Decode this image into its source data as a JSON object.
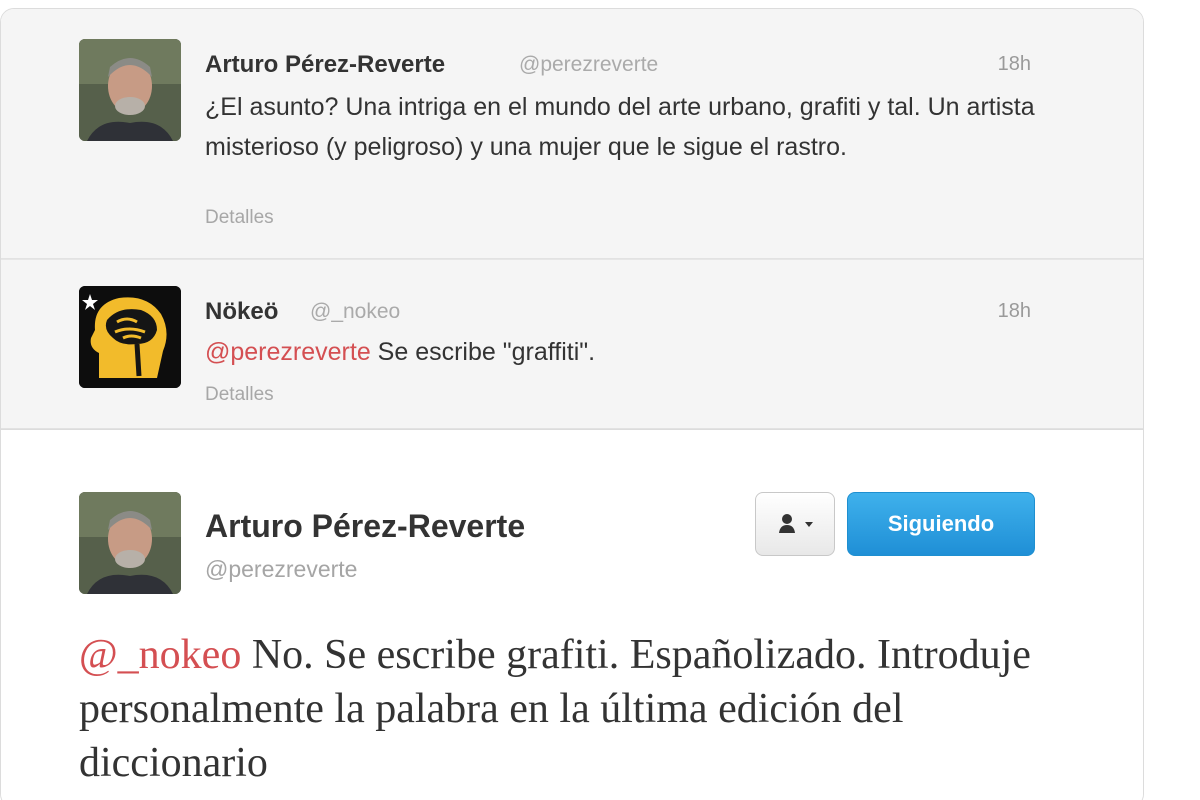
{
  "tweets": [
    {
      "name": "Arturo Pérez-Reverte",
      "handle": "@perezreverte",
      "time": "18h",
      "text": "¿El asunto? Una intriga en el mundo del arte urbano, grafiti y tal. Un artista misterioso (y peligroso) y una mujer que le sigue el rastro.",
      "details": "Detalles"
    },
    {
      "name": "Nökeö",
      "handle": "@_nokeo",
      "time": "18h",
      "mention": "@perezreverte",
      "text": " Se escribe \"graffiti\".",
      "details": "Detalles"
    }
  ],
  "main_tweet": {
    "name": "Arturo Pérez-Reverte",
    "handle": "@perezreverte",
    "follow_label": "Siguiendo",
    "mention": "@_nokeo",
    "text": " No. Se escribe grafiti. Españolizado. Introduje personalmente la palabra en la última edición del diccionario"
  },
  "icons": {
    "user_menu": "user-icon",
    "dropdown": "caret-down-icon"
  },
  "colors": {
    "mention": "#d44f52",
    "follow_button": "#2d9fe2",
    "timeline_bg": "#f5f5f5"
  }
}
